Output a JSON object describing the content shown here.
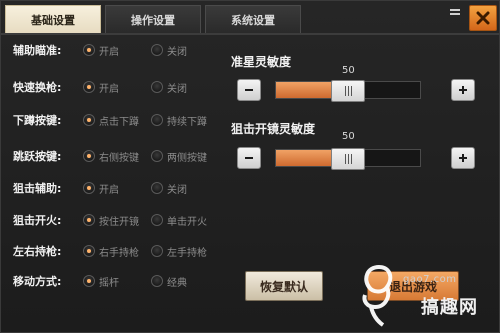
{
  "tabs": [
    {
      "label": "基础设置",
      "active": true
    },
    {
      "label": "操作设置",
      "active": false
    },
    {
      "label": "系统设置",
      "active": false
    }
  ],
  "settings": [
    {
      "label": "辅助瞄准:",
      "options": [
        "开启",
        "关闭"
      ],
      "selected": 0
    },
    {
      "label": "快速换枪:",
      "options": [
        "开启",
        "关闭"
      ],
      "selected": 0
    },
    {
      "label": "下蹲按键:",
      "options": [
        "点击下蹲",
        "持续下蹲"
      ],
      "selected": 0
    },
    {
      "label": "跳跃按键:",
      "options": [
        "右侧按键",
        "两侧按键"
      ],
      "selected": 0
    },
    {
      "label": "狙击辅助:",
      "options": [
        "开启",
        "关闭"
      ],
      "selected": 0
    },
    {
      "label": "狙击开火:",
      "options": [
        "按住开镜",
        "单击开火"
      ],
      "selected": 0
    },
    {
      "label": "左右持枪:",
      "options": [
        "右手持枪",
        "左手持枪"
      ],
      "selected": 0
    },
    {
      "label": "移动方式:",
      "options": [
        "摇杆",
        "经典"
      ],
      "selected": 0
    }
  ],
  "sliders": [
    {
      "title": "准星灵敏度",
      "value": "50",
      "fraction": 0.5
    },
    {
      "title": "狙击开镜灵敏度",
      "value": "50",
      "fraction": 0.5
    }
  ],
  "buttons": {
    "reset": "恢复默认",
    "exit": "退出游戏"
  },
  "watermark": {
    "url": "gao7.com",
    "name": "搞趣网"
  },
  "colors": {
    "accent": "#e07a2e",
    "active_tab": "#efe6cf",
    "close": "#e58a2e"
  },
  "icons": {
    "menu": "menu-icon",
    "close": "close-icon",
    "minus": "minus-icon",
    "plus": "plus-icon"
  }
}
